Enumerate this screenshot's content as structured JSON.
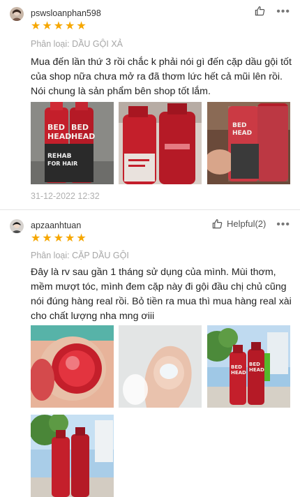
{
  "reviews": [
    {
      "username": "pswsloanphan598",
      "rating": 5,
      "variant": "Phân loại: DẦU GỘI XẢ",
      "text": "Mua đến lần thứ 3 rồi chắc k phải nói gì đến cặp dầu gội tốt của shop nữa chưa mở ra đã thơm lức hết cả mũi lên rồi. Nói chung là sản phẩm bên shop tốt lắm.",
      "date": "31-12-2022 12:32",
      "like_label": "",
      "more_label": "•••"
    },
    {
      "username": "apzaanhtuan",
      "rating": 5,
      "variant": "Phân loại: CẶP DẦU GỘI",
      "text": "Đây là rv sau gần 1 tháng sử dụng của mình. Mùi thơm, mềm mượt tóc, mình đem cặp này đi gội đầu chị chủ cũng nói đúng hàng real rồi. Bỏ tiền ra mua thì mua hàng real xài cho chất lượng nha mng ơiii",
      "like_label": "Helpful(2)",
      "more_label": "•••"
    }
  ],
  "product_label": {
    "brand_line1": "BED",
    "brand_line2": "HEAD",
    "product_line1": "REHAB",
    "product_line2": "FOR HAIR"
  },
  "icons": {
    "star": "star-icon",
    "like": "thumbs-up-icon",
    "more": "more-options-icon"
  },
  "colors": {
    "star": "#f6a700",
    "bottle_red": "#c41f2b",
    "divider": "#e4e4e4"
  }
}
